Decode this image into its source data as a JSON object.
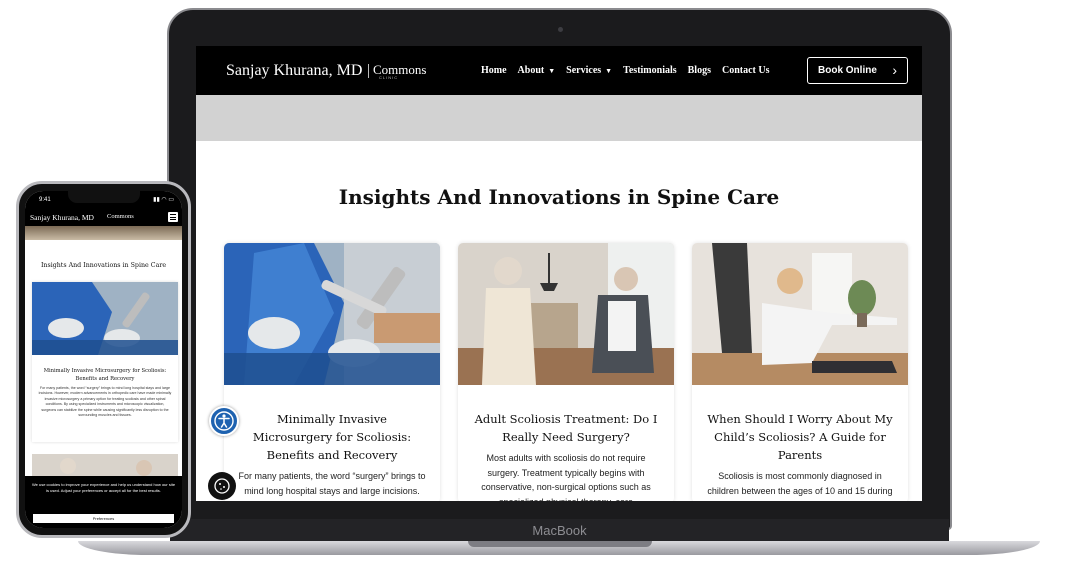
{
  "laptop": {
    "brand": "MacBook",
    "site": {
      "logo": {
        "name": "Sanjay Khurana, MD",
        "sub": "Commons",
        "clinic": "CLINIC"
      },
      "nav": {
        "home": "Home",
        "about": "About",
        "services": "Services",
        "testimonials": "Testimonials",
        "blogs": "Blogs",
        "contact": "Contact Us"
      },
      "book_button": "Book Online",
      "section_title": "Insights And Innovations in Spine Care",
      "cards": [
        {
          "title": "Minimally Invasive Microsurgery for Scoliosis: Benefits and Recovery",
          "excerpt": "For many patients, the word “surgery” brings to mind long hospital stays and large incisions. However, modern advancements"
        },
        {
          "title": "Adult Scoliosis Treatment: Do I Really Need Surgery?",
          "excerpt": "Most adults with scoliosis do not require surgery. Treatment typically begins with conservative, non-surgical options such as specialized physical therapy, core"
        },
        {
          "title": "When Should I Worry About My Child’s Scoliosis? A Guide for Parents",
          "excerpt": "Scoliosis is most commonly diagnosed in children between the ages of 10 and 15 during"
        }
      ]
    }
  },
  "phone": {
    "status_time": "9:41",
    "site": {
      "logo": "Sanjay Khurana, MD",
      "logo_sub": "Commons",
      "section_title": "Insights And Innovations in Spine Care",
      "card": {
        "title": "Minimally Invasive Microsurgery for Scoliosis: Benefits and Recovery",
        "excerpt": "For many patients, the word “surgery” brings to mind long hospital stays and large incisions. However, modern advancements in orthopedic care have made minimally invasive microsurgery a primary option for treating scoliosis and other spinal conditions. By using specialized instruments and microscopic visualization, surgeons can stabilize the spine while causing significantly less disruption to the surrounding muscles and tissues."
      },
      "cookie_text": "We use cookies to improve your experience and help us understand how our site is used. Adjust your preferences or accept all for the best results.",
      "preferences_button": "Preferences"
    }
  },
  "colors": {
    "accessibility": "#1e62b0",
    "nav_bg": "#000000"
  },
  "icons": [
    "accessibility-icon",
    "cookie-icon",
    "chevron-right-icon",
    "caret-down-icon",
    "menu-icon"
  ]
}
